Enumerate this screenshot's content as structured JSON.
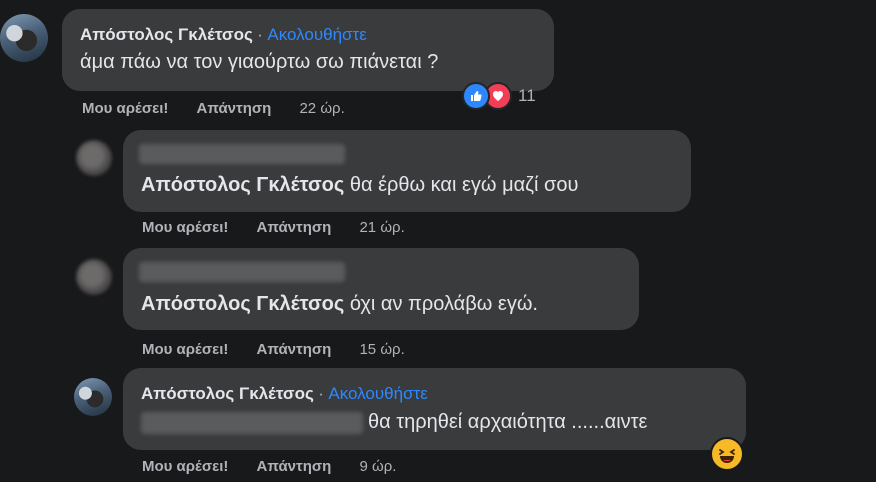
{
  "comments": [
    {
      "author": "Απόστολος Γκλέτσος",
      "separator": "·",
      "follow": "Ακολουθήστε",
      "text": "άμα πάω να τον γιαούρτω σω πιάνεται ?",
      "like": "Μου αρέσει!",
      "reply": "Απάντηση",
      "time": "22 ώρ.",
      "reaction_count": "11",
      "reaction_icons": [
        "like-icon",
        "love-icon"
      ],
      "colors": {
        "like": "#2d88ff",
        "love": "#f33e58"
      }
    },
    {
      "mention": "Απόστολος Γκλέτσος",
      "text": "θα έρθω και εγώ μαζί σου",
      "like": "Μου αρέσει!",
      "reply": "Απάντηση",
      "time": "21 ώρ."
    },
    {
      "mention": "Απόστολος Γκλέτσος",
      "text": "όχι αν προλάβω εγώ.",
      "like": "Μου αρέσει!",
      "reply": "Απάντηση",
      "time": "15 ώρ."
    },
    {
      "author": "Απόστολος Γκλέτσος",
      "separator": "·",
      "follow": "Ακολουθήστε",
      "text": "θα τηρηθεί αρχαιότητα ......αιντε",
      "like": "Μου αρέσει!",
      "reply": "Απάντηση",
      "time": "9 ώρ.",
      "reaction_icons": [
        "laughing-emoji-icon"
      ]
    }
  ],
  "theme": {
    "background": "#18191a",
    "bubble": "#3a3b3c",
    "link": "#2d88ff",
    "muted": "#b0b3b8"
  }
}
